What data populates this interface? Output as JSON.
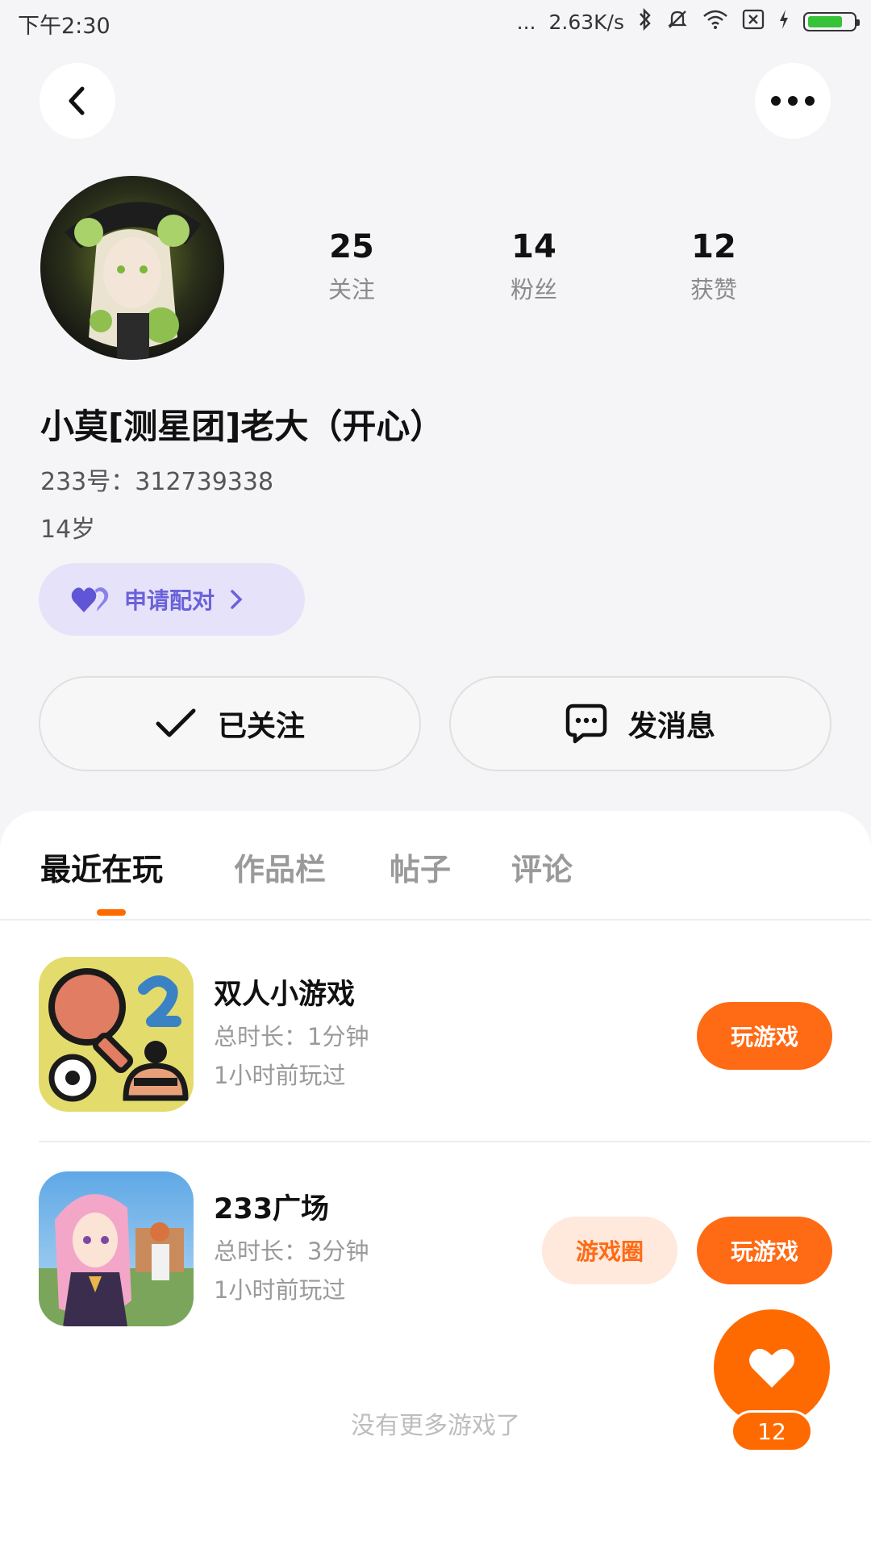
{
  "status_bar": {
    "time": "下午2:30",
    "dots": "...",
    "network_speed": "2.63K/s"
  },
  "profile": {
    "stats": [
      {
        "value": "25",
        "label": "关注"
      },
      {
        "value": "14",
        "label": "粉丝"
      },
      {
        "value": "12",
        "label": "获赞"
      }
    ],
    "username": "小莫[测星团]老大（开心）",
    "uid_label": "233号：",
    "uid": "312739338",
    "age": "14岁",
    "pair_button": "申请配对",
    "follow_button": "已关注",
    "message_button": "发消息"
  },
  "tabs": [
    {
      "label": "最近在玩",
      "active": true
    },
    {
      "label": "作品栏",
      "active": false
    },
    {
      "label": "帖子",
      "active": false
    },
    {
      "label": "评论",
      "active": false
    }
  ],
  "games": [
    {
      "name": "双人小游戏",
      "duration": "总时长：1分钟",
      "last_played": "1小时前玩过",
      "play_label": "玩游戏",
      "icon": "ping-pong-game-icon"
    },
    {
      "name": "233广场",
      "duration": "总时长：3分钟",
      "last_played": "1小时前玩过",
      "circle_label": "游戏圈",
      "play_label": "玩游戏",
      "icon": "anime-girl-game-icon"
    }
  ],
  "empty_text": "没有更多游戏了",
  "like": {
    "count": "12"
  },
  "colors": {
    "accent": "#ff6a14",
    "pair_bg": "#e5e2fa",
    "pair_text": "#6b61d9",
    "background": "#f5f5f7"
  }
}
